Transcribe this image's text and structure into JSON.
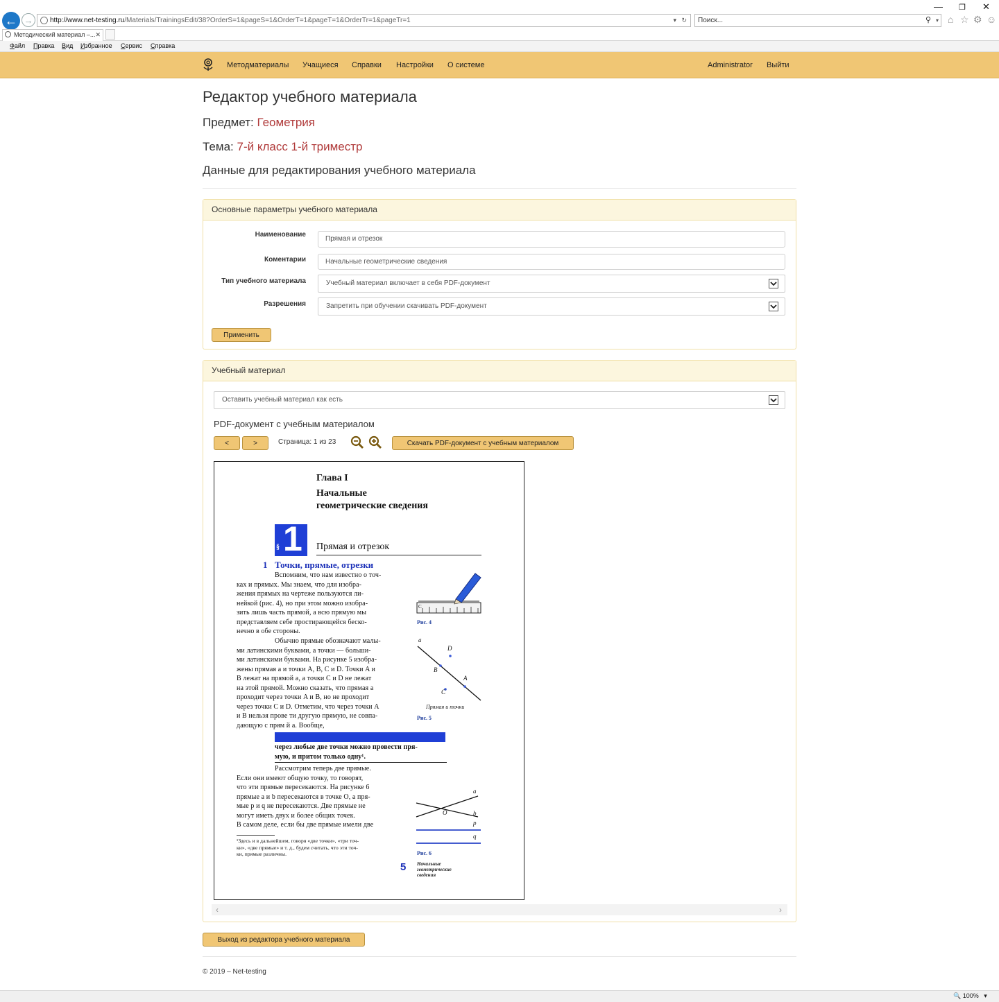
{
  "browser": {
    "url_host": "http://www.net-testing.ru",
    "url_path": "/Materials/TrainingsEdit/38?OrderS=1&pageS=1&OrderT=1&pageT=1&OrderTr=1&pageTr=1",
    "search_placeholder": "Поиск...",
    "tab_title": "Методический материал –...",
    "menu": [
      "Файл",
      "Правка",
      "Вид",
      "Избранное",
      "Сервис",
      "Справка"
    ],
    "zoom": "100%"
  },
  "nav": {
    "items": [
      "Методматериалы",
      "Учащиеся",
      "Справки",
      "Настройки",
      "О системе"
    ],
    "user": "Administrator",
    "logout": "Выйти"
  },
  "page": {
    "title": "Редактор учебного материала",
    "subject_label": "Предмет:",
    "subject_value": "Геометрия",
    "topic_label": "Тема:",
    "topic_value": "7-й класс 1-й триместр",
    "section_heading": "Данные для редактирования учебного материала"
  },
  "params_panel": {
    "heading": "Основные параметры учебного материала",
    "name_label": "Наименование",
    "name_value": "Прямая и отрезок",
    "comment_label": "Коментарии",
    "comment_value": "Начальные геометрические сведения",
    "type_label": "Тип учебного материала",
    "type_value": "Учебный материал включает в себя PDF-документ",
    "perm_label": "Разрешения",
    "perm_value": "Запретить при обучении скачивать PDF-документ",
    "apply_button": "Применить"
  },
  "material_panel": {
    "heading": "Учебный материал",
    "action_value": "Оставить учебный материал как есть",
    "pdf_title": "PDF-документ с учебным материалом",
    "prev_button": "<",
    "next_button": ">",
    "page_info": "Страница: 1 из 23",
    "download_button": "Скачать PDF-документ с учебным материалом"
  },
  "pdf_page": {
    "chapter": "Глава I",
    "chapter_title_1": "Начальные",
    "chapter_title_2": "геометрические сведения",
    "section_number": "1",
    "section_mark": "§",
    "section_title": "Прямая и отрезок",
    "sub_number": "1",
    "sub_title": "Точки, прямые, отрезки",
    "para1": [
      "Вспомним, что нам известно о точ-",
      "ках и прямых. Мы знаем, что для изобра-",
      "жения прямых на чертеже пользуются ли-",
      "нейкой (рис. 4), но при этом можно изобра-",
      "зить лишь часть прямой, а всю прямую мы",
      "представляем себе простирающейся беско-",
      "нечно в обе стороны."
    ],
    "para2": [
      "Обычно прямые обозначают малы-",
      "ми латинскими буквами, а точки — больши-",
      "ми латинскими буквами. На рисунке 5 изобра-",
      "жены прямая a и точки A, B, C и D. Точки A и",
      "B лежат на прямой a, а точки C и D не лежат",
      "на этой прямой. Можно сказать, что прямая a",
      "проходит через точки A и B, но не проходит",
      "через точки C и D. Отметим, что через точки A",
      "и B нельзя прове ти другую прямую, не совпа-",
      "дающую с прям й a. Вообще,"
    ],
    "highlight": [
      "через любые две точки можно провести пря-",
      "мую, и притом только одну¹."
    ],
    "para3": [
      "Рассмотрим теперь две прямые.",
      "Если они имеют общую точку, то говорят,",
      "что эти прямые пересекаются. На рисунке 6",
      "прямые a и b пересекаются в точке O, а пря-",
      "мые p и q не пересекаются. Две прямые не",
      "могут иметь двух и более общих точек.",
      "В самом деле, если бы две прямые имели две"
    ],
    "footnote": [
      "¹Здесь и в дальнейшем, говоря «две точки», «три точ-",
      "ки», «две прямые» и т. д., будем считать, что эти точ-",
      "ки, прямые различны."
    ],
    "fig4": "Рис. 4",
    "fig5": "Рис. 5",
    "fig5_caption": "Прямая и точки",
    "fig6": "Рис. 6",
    "side_note": [
      "Начальные",
      "геометрические",
      "сведения"
    ],
    "page_number": "5",
    "labels": {
      "a": "a",
      "b": "b",
      "p": "p",
      "q": "q",
      "A": "A",
      "B": "B",
      "C": "C",
      "D": "D",
      "O": "O",
      "ruler_c": "C"
    }
  },
  "exit_button": "Выход из редактора учебного материала",
  "footer": "© 2019 – Net-testing"
}
